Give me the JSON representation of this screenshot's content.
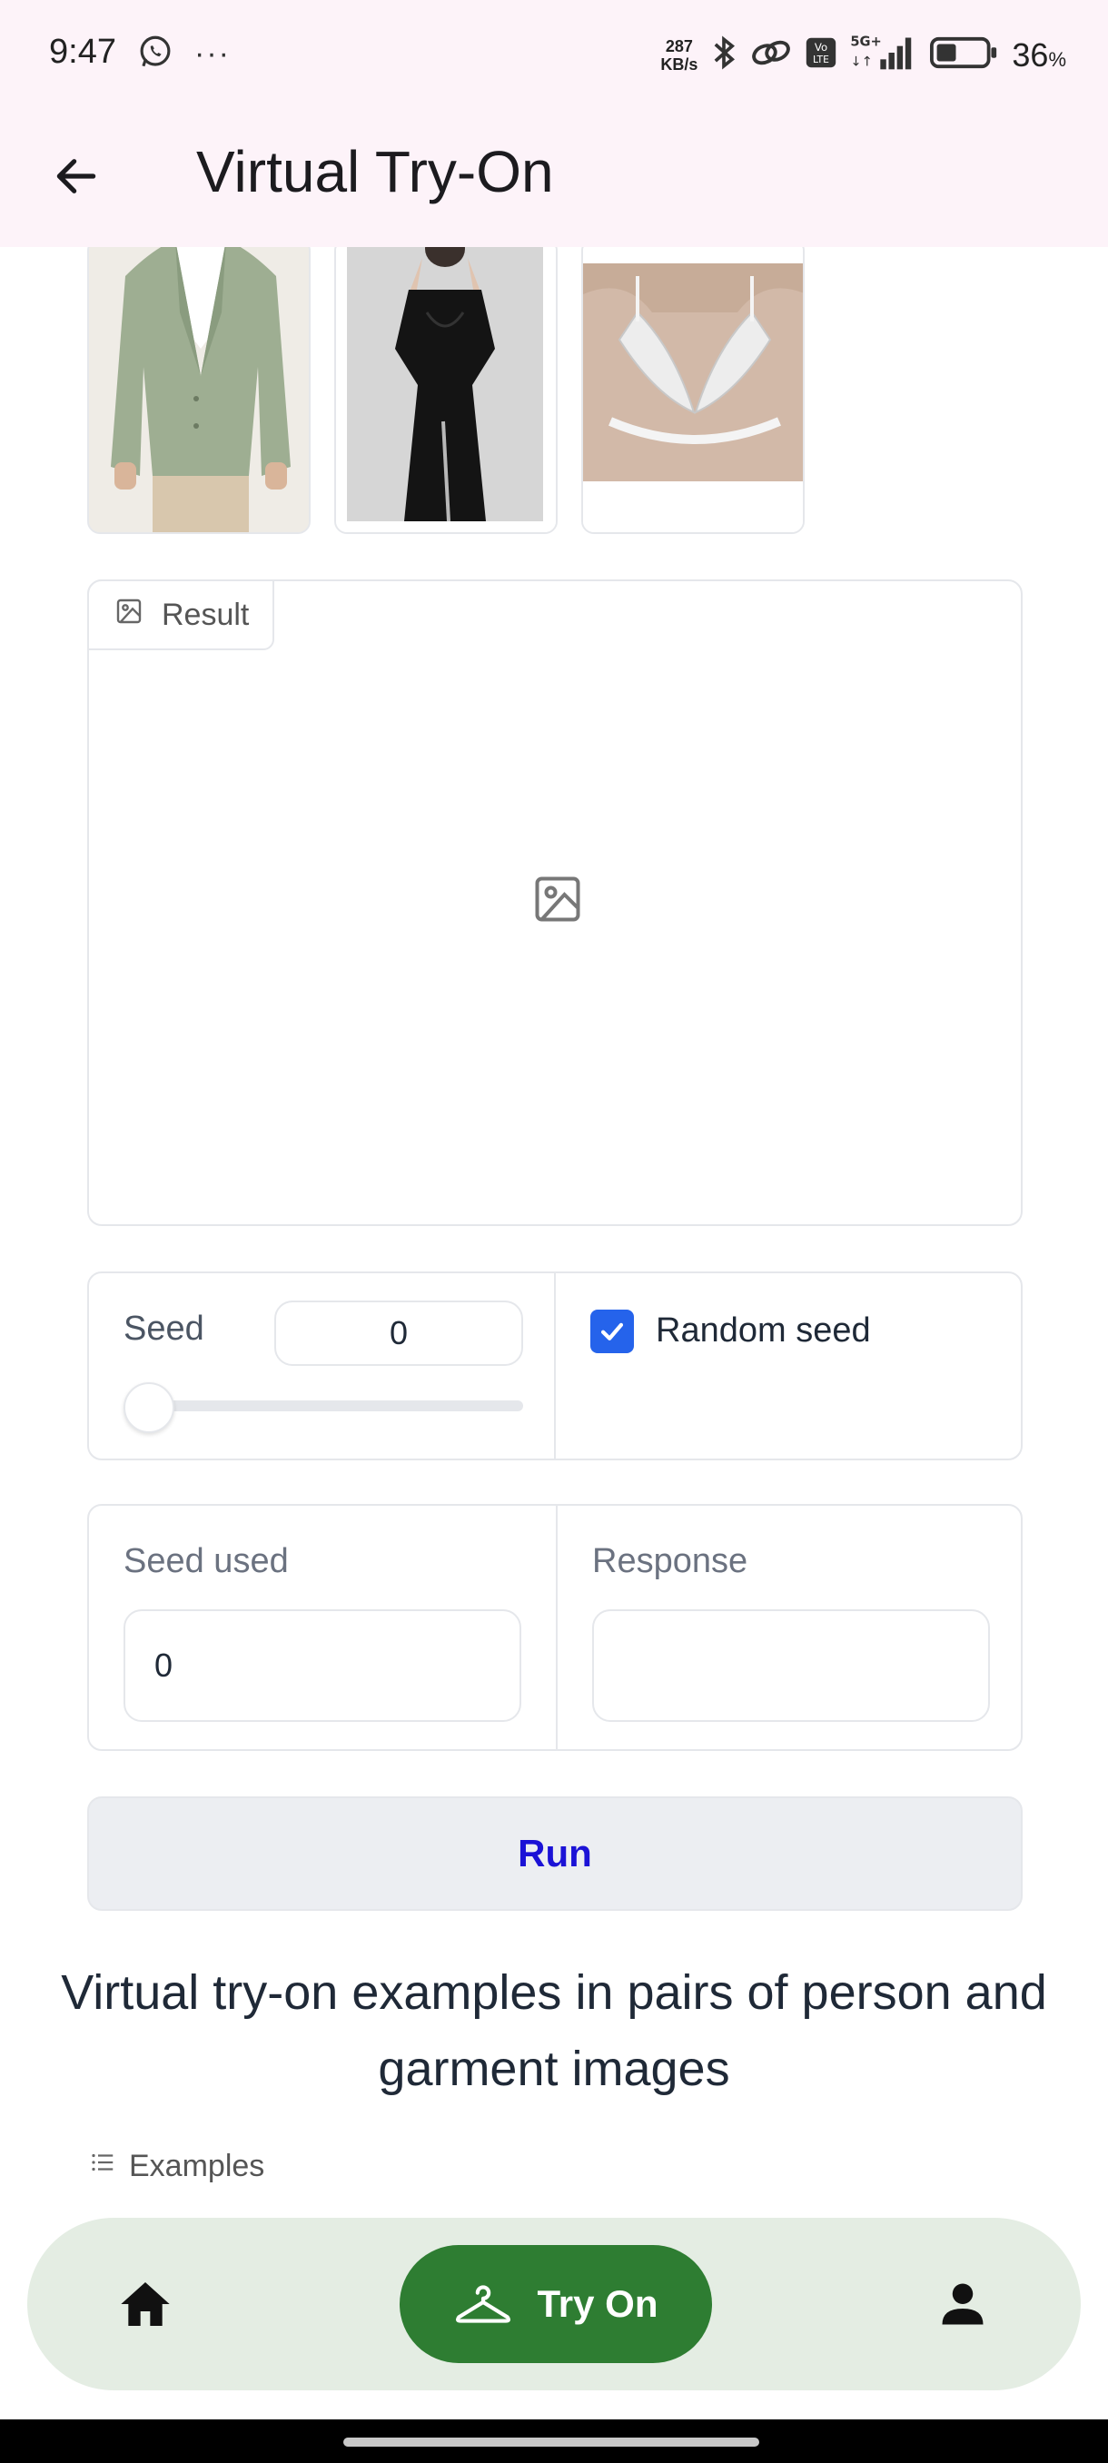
{
  "status_bar": {
    "time": "9:47",
    "net_speed_value": "287",
    "net_speed_unit": "KB/s",
    "network_type": "5G+",
    "volte": "Vo LTE",
    "battery_percent": "36",
    "battery_suffix": "%",
    "overflow": "···"
  },
  "app_bar": {
    "title": "Virtual Try-On"
  },
  "gallery": {
    "items": [
      "green-blazer-garment",
      "black-dress-garment",
      "white-lace-bra-garment"
    ]
  },
  "result": {
    "label": "Result"
  },
  "seed": {
    "label": "Seed",
    "value": "0",
    "slider_level": 0,
    "random_seed_label": "Random seed",
    "random_seed_checked": true
  },
  "outputs": {
    "seed_used_label": "Seed used",
    "seed_used_value": "0",
    "response_label": "Response",
    "response_value": ""
  },
  "run_button": {
    "label": "Run"
  },
  "examples": {
    "heading": "Virtual try-on examples in pairs of person and garment images",
    "label": "Examples"
  },
  "bottom_nav": {
    "try_on_label": "Try On",
    "active_color": "#2e7d32"
  },
  "colors": {
    "status_bg": "#fdf3f9",
    "run_text": "#1b12d6",
    "checkbox": "#2563eb",
    "nav_bg": "#e4ede3"
  }
}
